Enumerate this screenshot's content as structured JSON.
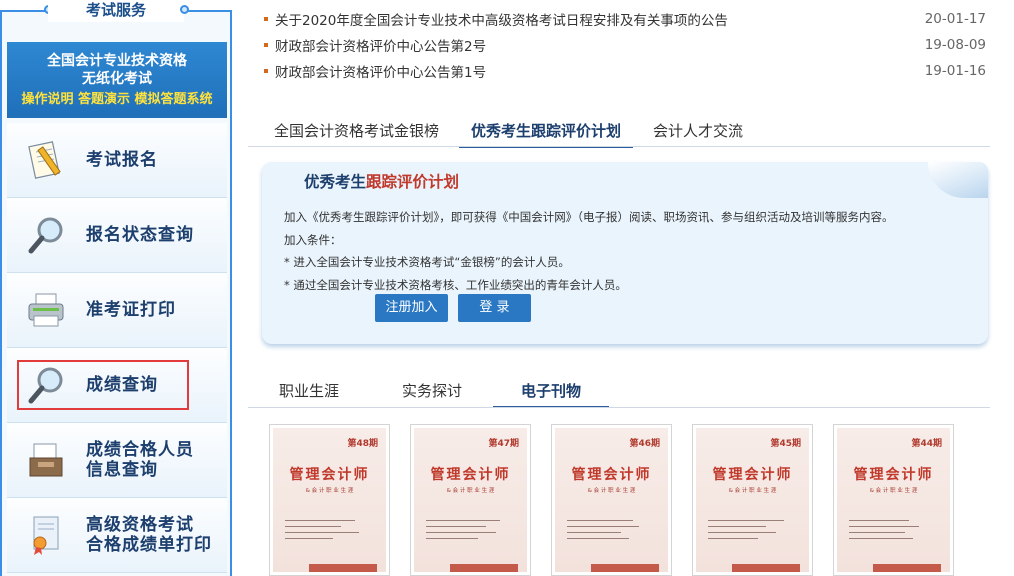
{
  "sidebar": {
    "title": "考试服务",
    "banner": {
      "line1": "全国会计专业技术资格",
      "line2": "无纸化考试",
      "links": "操作说明 答题演示 模拟答题系统"
    },
    "items": [
      {
        "label_lines": [
          "考试报名"
        ],
        "icon": "notepad-pencil-icon"
      },
      {
        "label_lines": [
          "报名状态查询"
        ],
        "icon": "magnifier-icon"
      },
      {
        "label_lines": [
          "准考证打印"
        ],
        "icon": "printer-icon"
      },
      {
        "label_lines": [
          "成绩查询"
        ],
        "icon": "magnifier-icon",
        "selected": true
      },
      {
        "label_lines": [
          "成绩合格人员",
          "信息查询"
        ],
        "icon": "inbox-tray-icon"
      },
      {
        "label_lines": [
          "高级资格考试",
          "合格成绩单打印"
        ],
        "icon": "certificate-ribbon-icon"
      }
    ]
  },
  "news": [
    {
      "title": "关于2020年度全国会计专业技术中高级资格考试日程安排及有关事项的公告",
      "date": "20-01-17"
    },
    {
      "title": "财政部会计资格评价中心公告第2号",
      "date": "19-08-09"
    },
    {
      "title": "财政部会计资格评价中心公告第1号",
      "date": "19-01-16"
    }
  ],
  "tabs1": [
    "全国会计资格考试金银榜",
    "优秀考生跟踪评价计划",
    "会计人才交流"
  ],
  "tabs1_active": 1,
  "panel": {
    "title_a": "优秀考生",
    "title_b": "跟踪评价计划",
    "desc": "加入《优秀考生跟踪评价计划》，即可获得《中国会计网》（电子报）阅读、职场资讯、参与组织活动及培训等服务内容。",
    "cond_label": "加入条件：",
    "cond1": "* 进入全国会计专业技术资格考试“金银榜”的会计人员。",
    "cond2": "* 通过全国会计专业技术资格考核、工作业绩突出的青年会计人员。",
    "register_btn": "注册加入",
    "login_btn": "登 录"
  },
  "tabs2": [
    "职业生涯",
    "实务探讨",
    "电子刊物"
  ],
  "tabs2_active": 2,
  "covers": [
    {
      "issue": "第48期",
      "title": "管理会计师",
      "subtitle": "& 会 计 职 业 生 涯"
    },
    {
      "issue": "第47期",
      "title": "管理会计师",
      "subtitle": "& 会 计 职 业 生 涯"
    },
    {
      "issue": "第46期",
      "title": "管理会计师",
      "subtitle": "& 会 计 职 业 生 涯"
    },
    {
      "issue": "第45期",
      "title": "管理会计师",
      "subtitle": "& 会 计 职 业 生 涯"
    },
    {
      "issue": "第44期",
      "title": "管理会计师",
      "subtitle": "& 会 计 职 业 生 涯"
    }
  ],
  "colors": {
    "accent": "#2a78c4",
    "highlight": "#e23b3b",
    "brand_red": "#c0392b"
  }
}
